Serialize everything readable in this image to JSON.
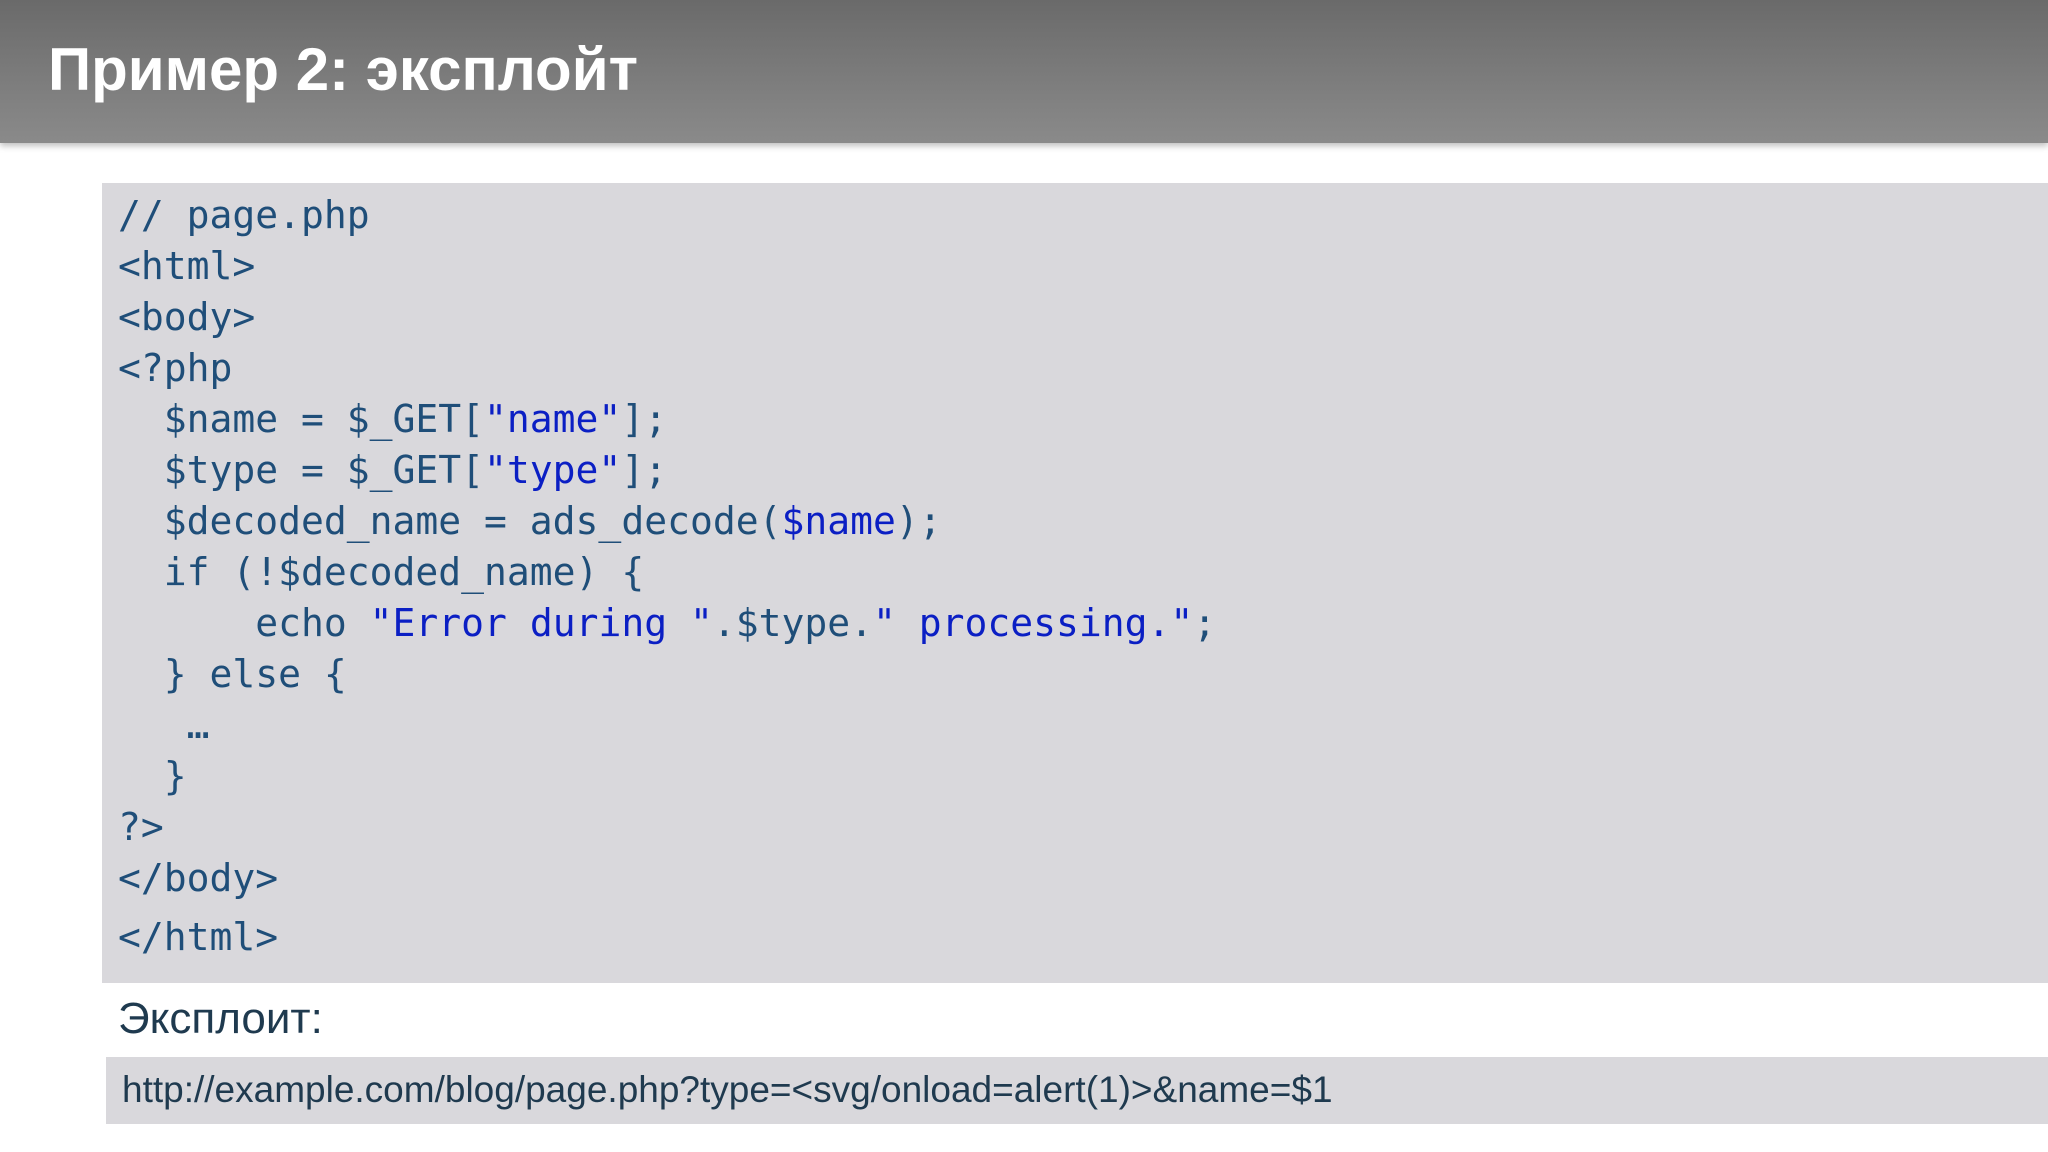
{
  "slide": {
    "title": "Пример 2: эксплойт"
  },
  "code": {
    "line1": "// page.php",
    "line2": "<html>",
    "line3": "<body>",
    "line4": "<?php",
    "line5_a": "  $name = $_GET[",
    "line5_b": "\"name\"",
    "line5_c": "];",
    "line6_a": "  $type = $_GET[",
    "line6_b": "\"type\"",
    "line6_c": "];",
    "line7_a": "  $decoded_name = ads_decode(",
    "line7_b": "$name",
    "line7_c": ");",
    "line8": "  if (!$decoded_name) {",
    "line9_a": "      echo ",
    "line9_b": "\"Error during \"",
    "line9_c": ".$type.",
    "line9_d": "\" processing.\"",
    "line9_e": ";",
    "line10": "  } else {",
    "line11": "   …",
    "line12": "  }",
    "line13": "?>",
    "line14": "</body>",
    "line15": "</html>"
  },
  "exploit": {
    "label": "Эксплоит:",
    "url": "http://example.com/blog/page.php?type=<svg/onload=alert(1)>&name=$1"
  },
  "colors": {
    "title_bar": "#7c7c7c",
    "code_background": "#d9d8dc",
    "code_text": "#1f4e79",
    "string_text": "#0b1fc4"
  }
}
